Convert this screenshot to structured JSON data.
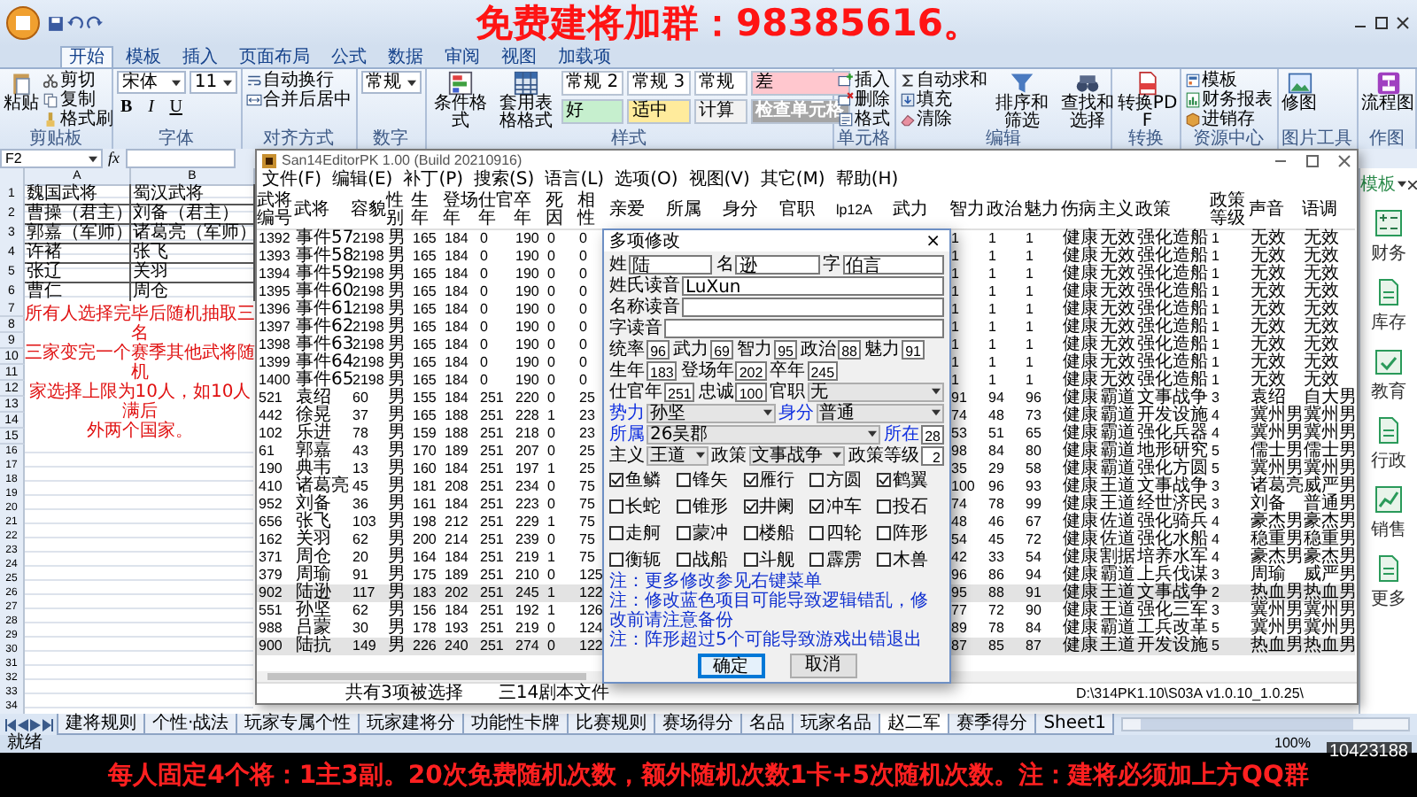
{
  "banner": {
    "text": "免费建将加群：98385616。"
  },
  "ribbon": {
    "tabs": [
      {
        "label": "开始",
        "selected": true
      },
      {
        "label": "模板",
        "selected": false
      },
      {
        "label": "插入",
        "selected": false
      },
      {
        "label": "页面布局",
        "selected": false
      },
      {
        "label": "公式",
        "selected": false
      },
      {
        "label": "数据",
        "selected": false
      },
      {
        "label": "审阅",
        "selected": false
      },
      {
        "label": "视图",
        "selected": false
      },
      {
        "label": "加载项",
        "selected": false
      }
    ],
    "groups": [
      {
        "label": "剪贴板",
        "columns": [
          [
            {
              "kind": "big",
              "label": "粘贴"
            }
          ],
          [
            {
              "kind": "small",
              "label": "剪切"
            },
            {
              "kind": "small",
              "label": "复制"
            },
            {
              "kind": "small",
              "label": "格式刷"
            }
          ]
        ]
      },
      {
        "label": "字体",
        "columns": [
          [
            {
              "kind": "field",
              "value": "宋体"
            },
            {
              "kind": "letters",
              "labels": [
                "B",
                "I",
                "U"
              ]
            }
          ],
          [
            {
              "kind": "field",
              "value": "11"
            }
          ]
        ]
      },
      {
        "label": "对齐方式",
        "columns": [
          [
            {
              "kind": "small",
              "label": "自动换行"
            },
            {
              "kind": "small",
              "label": "合并后居中"
            }
          ]
        ]
      },
      {
        "label": "数字",
        "columns": [
          [
            {
              "kind": "field",
              "value": "常规"
            }
          ]
        ]
      },
      {
        "label": "样式",
        "columns": [
          [
            {
              "kind": "big",
              "label": "条件格式"
            }
          ],
          [
            {
              "kind": "big",
              "label": "套用表格格式"
            }
          ],
          [
            {
              "kind": "style",
              "label": "常规 2",
              "color": "#ffffff"
            },
            {
              "kind": "style",
              "label": "好",
              "color": "#c6efce"
            }
          ],
          [
            {
              "kind": "style",
              "label": "常规 3",
              "color": "#ffffff"
            },
            {
              "kind": "style",
              "label": "适中",
              "color": "#ffeb9c"
            }
          ],
          [
            {
              "kind": "style",
              "label": "常规",
              "color": "#ffffff"
            },
            {
              "kind": "style",
              "label": "计算",
              "color": "#f2f2f2"
            }
          ],
          [
            {
              "kind": "style",
              "label": "差",
              "color": "#ffc7ce"
            },
            {
              "kind": "style",
              "label": "检查单元格",
              "color": "#a5a5a5"
            }
          ]
        ]
      },
      {
        "label": "单元格",
        "columns": [
          [
            {
              "kind": "small",
              "label": "插入"
            },
            {
              "kind": "small",
              "label": "删除"
            },
            {
              "kind": "small",
              "label": "格式"
            }
          ]
        ]
      },
      {
        "label": "编辑",
        "columns": [
          [
            {
              "kind": "small",
              "label": "自动求和"
            },
            {
              "kind": "small",
              "label": "填充"
            },
            {
              "kind": "small",
              "label": "清除"
            }
          ],
          [
            {
              "kind": "big",
              "label": "排序和筛选"
            }
          ],
          [
            {
              "kind": "big",
              "label": "查找和选择"
            }
          ]
        ]
      },
      {
        "label": "转换",
        "columns": [
          [
            {
              "kind": "big",
              "label": "转换PDF"
            }
          ]
        ]
      },
      {
        "label": "资源中心",
        "columns": [
          [
            {
              "kind": "small",
              "label": "模板"
            },
            {
              "kind": "small",
              "label": "财务报表"
            },
            {
              "kind": "small",
              "label": "进销存"
            }
          ]
        ]
      },
      {
        "label": "图片工具",
        "columns": [
          [
            {
              "kind": "big",
              "label": "修图"
            }
          ]
        ]
      },
      {
        "label": "作图",
        "columns": [
          [
            {
              "kind": "big",
              "label": "流程图"
            }
          ]
        ]
      }
    ]
  },
  "sheet": {
    "name_box": "F2",
    "function_label": "fx",
    "columns": [
      "A",
      "B"
    ],
    "rows": [
      {
        "number": "1",
        "cells": [
          "魏国武将",
          "蜀汉武将"
        ]
      },
      {
        "number": "2",
        "cells": [
          "曹操（君主）",
          "刘备（君主）"
        ]
      },
      {
        "number": "3",
        "cells": [
          "郭嘉（军师）",
          "诸葛亮（军师）"
        ]
      },
      {
        "number": "4",
        "cells": [
          "许褚",
          "张飞"
        ]
      },
      {
        "number": "5",
        "cells": [
          "张辽",
          "关羽"
        ]
      },
      {
        "number": "6",
        "cells": [
          "曹仁",
          "周仓"
        ]
      }
    ],
    "note_rows": [
      "7",
      "8",
      "9",
      "10",
      "11",
      "12",
      "13",
      "14",
      "15"
    ],
    "note_lines": [
      "所有人选择完毕后随机抽取三名",
      "三家变完一个赛季其他武将随机",
      "家选择上限为10人，如10人满后",
      "外两个国家。"
    ],
    "empty_rows": [
      "16",
      "17",
      "18",
      "19",
      "20",
      "21",
      "22",
      "23",
      "24",
      "25",
      "26",
      "27",
      "28",
      "29",
      "30",
      "31",
      "32",
      "33",
      "34"
    ]
  },
  "side_panel": {
    "title": "模板",
    "items": [
      "财务",
      "库存",
      "教育",
      "行政",
      "销售",
      "更多"
    ]
  },
  "sheet_tabs": [
    {
      "label": "建将规则",
      "selected": false
    },
    {
      "label": "个性·战法",
      "selected": false
    },
    {
      "label": "玩家专属个性",
      "selected": false
    },
    {
      "label": "玩家建将分",
      "selected": false
    },
    {
      "label": "功能性卡牌",
      "selected": false
    },
    {
      "label": "比赛规则",
      "selected": false
    },
    {
      "label": "赛场得分",
      "selected": false
    },
    {
      "label": "名品",
      "selected": false
    },
    {
      "label": "玩家名品",
      "selected": false
    },
    {
      "label": "赵二军",
      "selected": true
    },
    {
      "label": "赛季得分",
      "selected": false
    },
    {
      "label": "Sheet1",
      "selected": false
    }
  ],
  "excel_status": {
    "ready": "就绪",
    "zoom": "100%"
  },
  "editor": {
    "title": "San14EditorPK 1.00 (Build 20210916)",
    "menu": [
      "文件(F)",
      "编辑(E)",
      "补丁(P)",
      "搜索(S)",
      "语言(L)",
      "选项(O)",
      "视图(V)",
      "其它(M)",
      "帮助(H)"
    ],
    "columns": [
      "武将编号",
      "武将",
      "容貌",
      "性别",
      "生年",
      "登场年",
      "仕官年",
      "卒年",
      "死因",
      "相性",
      "亲爱",
      "所属",
      "身分",
      "官职",
      "lp12A",
      "武力",
      "智力",
      "政治",
      "魅力",
      "伤病",
      "主义",
      "政策",
      "政策等级",
      "声音",
      "语调"
    ],
    "rows": [
      {
        "selected": false,
        "cells": [
          "1392",
          "事件57",
          "2198",
          "男",
          "165",
          "184",
          "0",
          "190",
          "0",
          "0",
          "",
          "",
          "",
          "",
          "",
          "",
          "1",
          "1",
          "1",
          "健康",
          "无效",
          "强化造船",
          "1",
          "无效",
          "无效"
        ]
      },
      {
        "selected": false,
        "cells": [
          "1393",
          "事件58",
          "2198",
          "男",
          "165",
          "184",
          "0",
          "190",
          "0",
          "0",
          "",
          "",
          "",
          "",
          "",
          "",
          "1",
          "1",
          "1",
          "健康",
          "无效",
          "强化造船",
          "1",
          "无效",
          "无效"
        ]
      },
      {
        "selected": false,
        "cells": [
          "1394",
          "事件59",
          "2198",
          "男",
          "165",
          "184",
          "0",
          "190",
          "0",
          "0",
          "",
          "",
          "",
          "",
          "",
          "",
          "1",
          "1",
          "1",
          "健康",
          "无效",
          "强化造船",
          "1",
          "无效",
          "无效"
        ]
      },
      {
        "selected": false,
        "cells": [
          "1395",
          "事件60",
          "2198",
          "男",
          "165",
          "184",
          "0",
          "190",
          "0",
          "0",
          "",
          "",
          "",
          "",
          "",
          "",
          "1",
          "1",
          "1",
          "健康",
          "无效",
          "强化造船",
          "1",
          "无效",
          "无效"
        ]
      },
      {
        "selected": false,
        "cells": [
          "1396",
          "事件61",
          "2198",
          "男",
          "165",
          "184",
          "0",
          "190",
          "0",
          "0",
          "",
          "",
          "",
          "",
          "",
          "",
          "1",
          "1",
          "1",
          "健康",
          "无效",
          "强化造船",
          "1",
          "无效",
          "无效"
        ]
      },
      {
        "selected": false,
        "cells": [
          "1397",
          "事件62",
          "2198",
          "男",
          "165",
          "184",
          "0",
          "190",
          "0",
          "0",
          "",
          "",
          "",
          "",
          "",
          "",
          "1",
          "1",
          "1",
          "健康",
          "无效",
          "强化造船",
          "1",
          "无效",
          "无效"
        ]
      },
      {
        "selected": false,
        "cells": [
          "1398",
          "事件63",
          "2198",
          "男",
          "165",
          "184",
          "0",
          "190",
          "0",
          "0",
          "",
          "",
          "",
          "",
          "",
          "",
          "1",
          "1",
          "1",
          "健康",
          "无效",
          "强化造船",
          "1",
          "无效",
          "无效"
        ]
      },
      {
        "selected": false,
        "cells": [
          "1399",
          "事件64",
          "2198",
          "男",
          "165",
          "184",
          "0",
          "190",
          "0",
          "0",
          "",
          "",
          "",
          "",
          "",
          "",
          "1",
          "1",
          "1",
          "健康",
          "无效",
          "强化造船",
          "1",
          "无效",
          "无效"
        ]
      },
      {
        "selected": false,
        "cells": [
          "1400",
          "事件65",
          "2198",
          "男",
          "165",
          "184",
          "0",
          "190",
          "0",
          "0",
          "",
          "",
          "",
          "",
          "",
          "",
          "1",
          "1",
          "1",
          "健康",
          "无效",
          "强化造船",
          "1",
          "无效",
          "无效"
        ]
      },
      {
        "selected": false,
        "cells": [
          "521",
          "袁绍",
          "60",
          "男",
          "155",
          "184",
          "251",
          "220",
          "0",
          "25",
          "",
          "",
          "",
          "",
          "",
          "",
          "91",
          "94",
          "96",
          "健康",
          "霸道",
          "文事战争",
          "3",
          "袁绍",
          "自大男"
        ]
      },
      {
        "selected": false,
        "cells": [
          "442",
          "徐晃",
          "37",
          "男",
          "165",
          "188",
          "251",
          "228",
          "1",
          "23",
          "",
          "",
          "",
          "",
          "",
          "",
          "74",
          "48",
          "73",
          "健康",
          "霸道",
          "开发设施",
          "4",
          "冀州男",
          "冀州男"
        ]
      },
      {
        "selected": false,
        "cells": [
          "102",
          "乐进",
          "78",
          "男",
          "159",
          "188",
          "251",
          "218",
          "0",
          "23",
          "",
          "",
          "",
          "",
          "",
          "",
          "53",
          "51",
          "65",
          "健康",
          "霸道",
          "强化兵器",
          "4",
          "冀州男",
          "冀州男"
        ]
      },
      {
        "selected": false,
        "cells": [
          "61",
          "郭嘉",
          "43",
          "男",
          "170",
          "189",
          "251",
          "207",
          "0",
          "25",
          "",
          "",
          "",
          "",
          "",
          "",
          "98",
          "84",
          "80",
          "健康",
          "霸道",
          "地形研究",
          "5",
          "儒士男",
          "儒士男"
        ]
      },
      {
        "selected": false,
        "cells": [
          "190",
          "典韦",
          "13",
          "男",
          "160",
          "184",
          "251",
          "197",
          "1",
          "25",
          "",
          "",
          "",
          "",
          "",
          "",
          "35",
          "29",
          "58",
          "健康",
          "霸道",
          "强化方圆",
          "5",
          "冀州男",
          "冀州男"
        ]
      },
      {
        "selected": false,
        "cells": [
          "410",
          "诸葛亮",
          "45",
          "男",
          "181",
          "208",
          "251",
          "234",
          "0",
          "75",
          "",
          "",
          "",
          "",
          "",
          "",
          "100",
          "96",
          "93",
          "健康",
          "王道",
          "文事战争",
          "3",
          "诸葛亮",
          "威严男"
        ]
      },
      {
        "selected": false,
        "cells": [
          "952",
          "刘备",
          "36",
          "男",
          "161",
          "184",
          "251",
          "223",
          "0",
          "75",
          "",
          "",
          "",
          "",
          "",
          "",
          "74",
          "78",
          "99",
          "健康",
          "王道",
          "经世济民",
          "3",
          "刘备",
          "普通男"
        ]
      },
      {
        "selected": false,
        "cells": [
          "656",
          "张飞",
          "103",
          "男",
          "198",
          "212",
          "251",
          "229",
          "1",
          "75",
          "",
          "",
          "",
          "",
          "",
          "",
          "48",
          "46",
          "67",
          "健康",
          "佐道",
          "强化骑兵",
          "4",
          "豪杰男",
          "豪杰男"
        ]
      },
      {
        "selected": false,
        "cells": [
          "162",
          "关羽",
          "62",
          "男",
          "200",
          "214",
          "251",
          "239",
          "0",
          "75",
          "",
          "",
          "",
          "",
          "",
          "",
          "54",
          "45",
          "72",
          "健康",
          "佐道",
          "强化水船",
          "4",
          "稳重男",
          "稳重男"
        ]
      },
      {
        "selected": false,
        "cells": [
          "371",
          "周仓",
          "20",
          "男",
          "164",
          "184",
          "251",
          "219",
          "1",
          "75",
          "",
          "",
          "",
          "",
          "",
          "",
          "42",
          "33",
          "54",
          "健康",
          "割据",
          "培养水军",
          "4",
          "豪杰男",
          "豪杰男"
        ]
      },
      {
        "selected": false,
        "cells": [
          "379",
          "周瑜",
          "91",
          "男",
          "175",
          "189",
          "251",
          "210",
          "0",
          "125",
          "",
          "",
          "",
          "",
          "",
          "",
          "96",
          "86",
          "94",
          "健康",
          "霸道",
          "上兵伐谋",
          "3",
          "周瑜",
          "威严男"
        ]
      },
      {
        "selected": true,
        "cells": [
          "902",
          "陆逊",
          "117",
          "男",
          "183",
          "202",
          "251",
          "245",
          "1",
          "122",
          "",
          "",
          "",
          "",
          "",
          "",
          "95",
          "88",
          "91",
          "健康",
          "王道",
          "文事战争",
          "2",
          "热血男",
          "热血男"
        ]
      },
      {
        "selected": false,
        "cells": [
          "551",
          "孙坚",
          "62",
          "男",
          "156",
          "184",
          "251",
          "192",
          "1",
          "126",
          "",
          "",
          "",
          "",
          "",
          "",
          "77",
          "72",
          "90",
          "健康",
          "王道",
          "强化三军",
          "3",
          "冀州男",
          "冀州男"
        ]
      },
      {
        "selected": false,
        "cells": [
          "988",
          "吕蒙",
          "30",
          "男",
          "178",
          "193",
          "251",
          "219",
          "0",
          "124",
          "",
          "",
          "",
          "",
          "",
          "",
          "89",
          "78",
          "84",
          "健康",
          "霸道",
          "工兵改革",
          "5",
          "冀州男",
          "冀州男"
        ]
      },
      {
        "selected": true,
        "cells": [
          "900",
          "陆抗",
          "149",
          "男",
          "226",
          "240",
          "251",
          "274",
          "0",
          "122",
          "",
          "",
          "",
          "",
          "",
          "",
          "87",
          "85",
          "87",
          "健康",
          "王道",
          "开发设施",
          "5",
          "热血男",
          "热血男"
        ]
      }
    ],
    "status": [
      "共有3项被选择",
      "三14剧本文件",
      "D:\\314PK1.10\\S03A v1.0.10_1.0.25\\"
    ]
  },
  "dialog": {
    "title": "多项修改",
    "close": "×",
    "rows": [
      {
        "fields": [
          {
            "kind": "text",
            "label": "姓",
            "value": "陆",
            "blue": false
          },
          {
            "kind": "text",
            "label": "名",
            "value": "逊",
            "blue": false
          },
          {
            "kind": "text",
            "label": "字",
            "value": "伯言",
            "blue": false
          }
        ]
      },
      {
        "fields": [
          {
            "kind": "text",
            "label": "姓氏读音",
            "value": "LuXun",
            "blue": false
          }
        ]
      },
      {
        "fields": [
          {
            "kind": "text",
            "label": "名称读音",
            "blue": false
          }
        ]
      },
      {
        "fields": [
          {
            "kind": "text",
            "label": "字读音",
            "blue": false
          }
        ]
      },
      {
        "fields": [
          {
            "kind": "number",
            "label": "统率",
            "value": "96",
            "blue": false
          },
          {
            "kind": "number",
            "label": "武力",
            "value": "69",
            "blue": false
          },
          {
            "kind": "number",
            "label": "智力",
            "value": "95",
            "blue": false
          },
          {
            "kind": "number",
            "label": "政治",
            "value": "88",
            "blue": false
          },
          {
            "kind": "number",
            "label": "魅力",
            "value": "91",
            "blue": false
          }
        ]
      },
      {
        "fields": [
          {
            "kind": "number",
            "label": "生年",
            "value": "183",
            "blue": false
          },
          {
            "kind": "number",
            "label": "登场年",
            "value": "202",
            "blue": false
          },
          {
            "kind": "number",
            "label": "卒年",
            "value": "245",
            "blue": false
          }
        ]
      },
      {
        "fields": [
          {
            "kind": "number",
            "label": "仕官年",
            "value": "251",
            "blue": false
          },
          {
            "kind": "number",
            "label": "忠诚",
            "value": "100",
            "blue": false
          },
          {
            "kind": "select",
            "label": "官职",
            "value": "无",
            "blue": false
          }
        ]
      },
      {
        "fields": [
          {
            "kind": "select",
            "label": "势力",
            "value": "孙坚",
            "blue": true
          },
          {
            "kind": "select",
            "label": "身分",
            "value": "普通",
            "blue": true
          }
        ]
      },
      {
        "fields": [
          {
            "kind": "select",
            "label": "所属",
            "value": "26吴郡",
            "blue": true
          },
          {
            "kind": "number",
            "label": "所在",
            "value": "28",
            "blue": true
          }
        ]
      },
      {
        "fields": [
          {
            "kind": "select",
            "label": "主义",
            "value": "王道",
            "blue": false
          },
          {
            "kind": "select",
            "label": "政策",
            "value": "文事战争",
            "blue": false
          },
          {
            "kind": "number",
            "label": "政策等级",
            "value": "2",
            "blue": false
          }
        ]
      }
    ],
    "checkboxes": [
      {
        "label": "鱼鳞",
        "checked": true
      },
      {
        "label": "锋矢",
        "checked": false
      },
      {
        "label": "雁行",
        "checked": true
      },
      {
        "label": "方圆",
        "checked": false
      },
      {
        "label": "鹤翼",
        "checked": true
      },
      {
        "label": "长蛇",
        "checked": false
      },
      {
        "label": "锥形",
        "checked": false
      },
      {
        "label": "井阑",
        "checked": true
      },
      {
        "label": "冲车",
        "checked": true
      },
      {
        "label": "投石",
        "checked": false
      },
      {
        "label": "走舸",
        "checked": false
      },
      {
        "label": "蒙冲",
        "checked": false
      },
      {
        "label": "楼船",
        "checked": false
      },
      {
        "label": "四轮",
        "checked": false
      },
      {
        "label": "阵形",
        "checked": false
      },
      {
        "label": "衡轭",
        "checked": false
      },
      {
        "label": "战船",
        "checked": false
      },
      {
        "label": "斗舰",
        "checked": false
      },
      {
        "label": "霹雳",
        "checked": false
      },
      {
        "label": "木兽",
        "checked": false
      }
    ],
    "notes": [
      "注：更多修改参见右键菜单",
      "注：修改蓝色项目可能导致逻辑错乱，修改前请注意备份",
      "注：阵形超过5个可能导致游戏出错退出"
    ],
    "buttons": [
      {
        "label": "确定",
        "default": true
      },
      {
        "label": "取消",
        "default": false
      }
    ]
  },
  "caption": {
    "text": "每人固定4个将：1主3副。20次免费随机次数，额外随机次数1卡+5次随机次数。注：建将必须加上方QQ群",
    "viewer_id": "10423188"
  }
}
